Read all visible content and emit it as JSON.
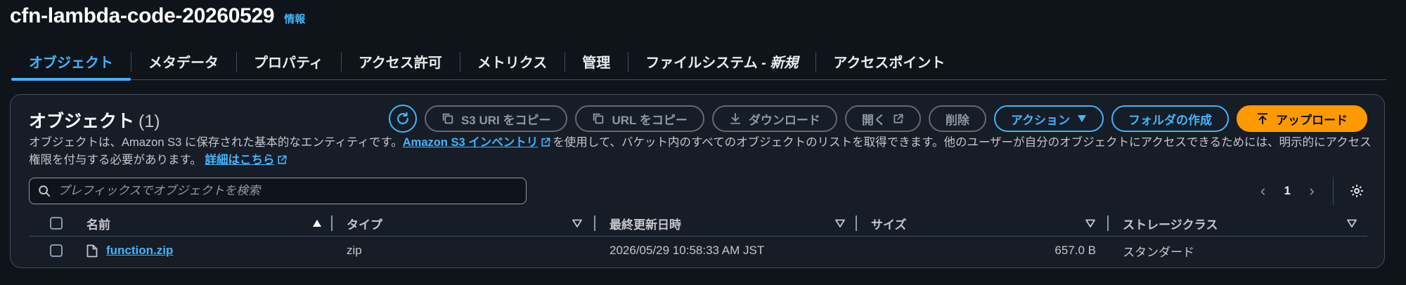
{
  "bucket": {
    "name": "cfn-lambda-code-20260529",
    "info_label": "情報"
  },
  "tabs": [
    {
      "label": "オブジェクト",
      "active": true
    },
    {
      "label": "メタデータ"
    },
    {
      "label": "プロパティ"
    },
    {
      "label": "アクセス許可"
    },
    {
      "label": "メトリクス"
    },
    {
      "label": "管理"
    },
    {
      "label": "ファイルシステム - ",
      "badge": "新規"
    },
    {
      "label": "アクセスポイント"
    }
  ],
  "objects_panel": {
    "title": "オブジェクト",
    "count": "(1)",
    "buttons": {
      "copy_s3_uri": "S3 URI をコピー",
      "copy_url": "URL をコピー",
      "download": "ダウンロード",
      "open": "開く",
      "delete": "削除",
      "actions": "アクション",
      "create_folder": "フォルダの作成",
      "upload": "アップロード"
    },
    "description": {
      "part1": "オブジェクトは、Amazon S3 に保存された基本的なエンティティです。",
      "inventory_link": "Amazon S3 インベントリ",
      "part2": "を使用して、バケット内のすべてのオブジェクトのリストを取得できます。他のユーザーが自分のオブジェクトにアクセスできるためには、明示的にアクセス権限を付与する必要があります。",
      "details_link": "詳細はこちら"
    },
    "search": {
      "placeholder": "プレフィックスでオブジェクトを検索",
      "value": ""
    },
    "pagination": {
      "current_page": "1"
    },
    "table": {
      "columns": [
        "名前",
        "タイプ",
        "最終更新日時",
        "サイズ",
        "ストレージクラス"
      ],
      "rows": [
        {
          "name": "function.zip",
          "type": "zip",
          "last_modified": "2026/05/29 10:58:33 AM JST",
          "size": "657.0 B",
          "storage_class": "スタンダード"
        }
      ]
    }
  },
  "colors": {
    "background": "#0f141a",
    "panel": "#161d26",
    "link": "#42b4ff",
    "primary": "#ff9900",
    "border": "#414d5c",
    "disabled": "#8d99a8"
  },
  "icons": {
    "refresh": "refresh-icon",
    "copy": "copy-icon",
    "download": "download-icon",
    "external": "external-link-icon",
    "caret": "caret-down-icon",
    "upload": "upload-icon",
    "search": "search-icon",
    "settings": "gear-icon",
    "file": "file-icon"
  }
}
